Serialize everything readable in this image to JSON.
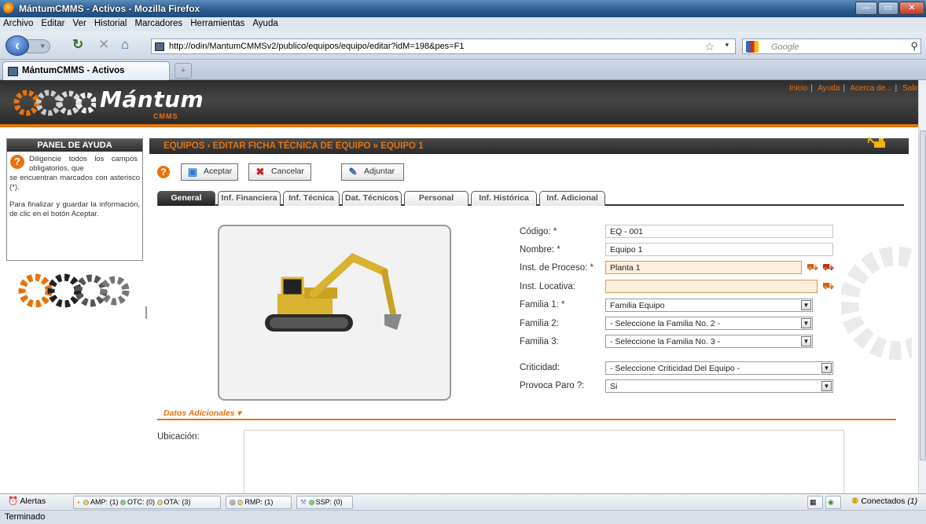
{
  "window": {
    "title": "MántumCMMS - Activos - Mozilla Firefox"
  },
  "menu": [
    "Archivo",
    "Editar",
    "Ver",
    "Historial",
    "Marcadores",
    "Herramientas",
    "Ayuda"
  ],
  "nav": {
    "url": "http://odin/MantumCMMSv2/publico/equipos/equipo/editar?idM=198&pes=F1",
    "search_placeholder": "Google"
  },
  "browser_tab": {
    "label": "MántumCMMS - Activos"
  },
  "brand": {
    "name": "Mántum",
    "sub": "CMMS",
    "accent": "#e8720c"
  },
  "toplinks": [
    "Inicio",
    "Ayuda",
    "Acerca de...",
    "Salir"
  ],
  "help": {
    "title": "PANEL DE AYUDA",
    "p1": "Diligencie todos los campos obligatorios, que",
    "p2": "se encuentran marcados con asterisco (*).",
    "p3": "Para finalizar y guardar la información, de clic en el botón Aceptar."
  },
  "breadcrumb": "EQUIPOS › EDITAR FICHA TÉCNICA DE EQUIPO » EQUIPO 1",
  "toolbar": {
    "accept": "Aceptar",
    "cancel": "Cancelar",
    "attach": "Adjuntar"
  },
  "tabs": [
    "General",
    "Inf. Financiera",
    "Inf. Técnica",
    "Dat. Técnicos",
    "Personal",
    "Inf. Histórica",
    "Inf. Adicional"
  ],
  "form": {
    "codigo": {
      "label": "Código: *",
      "value": "EQ - 001"
    },
    "nombre": {
      "label": "Nombre: *",
      "value": "Equipo 1"
    },
    "inst_proceso": {
      "label": "Inst. de Proceso: *",
      "value": "Planta 1"
    },
    "inst_locativa": {
      "label": "Inst. Locativa:",
      "value": ""
    },
    "familia1": {
      "label": "Familia 1: *",
      "value": "Familia Equipo"
    },
    "familia2": {
      "label": "Familia 2:",
      "value": "- Seleccione la Familia No. 2 -"
    },
    "familia3": {
      "label": "Familia 3:",
      "value": "- Seleccione la Familia No. 3 -"
    },
    "criticidad": {
      "label": "Criticidad:",
      "value": "- Seleccione Criticidad Del Equipo -"
    },
    "paro": {
      "label": "Provoca Paro ?:",
      "value": "Si"
    }
  },
  "datos_adicionales": "Datos Adicionales",
  "ubicacion_label": "Ubicación:",
  "status": {
    "alerts": "Alertas",
    "amp": "AMP: (1)",
    "otc": "OTC: (0)",
    "ota": "OTA: (3)",
    "rmp": "RMP: (1)",
    "ssp": "SSP: (0)",
    "conectados": "Conectados",
    "conectados_count": "(1)",
    "done": "Terminado"
  }
}
